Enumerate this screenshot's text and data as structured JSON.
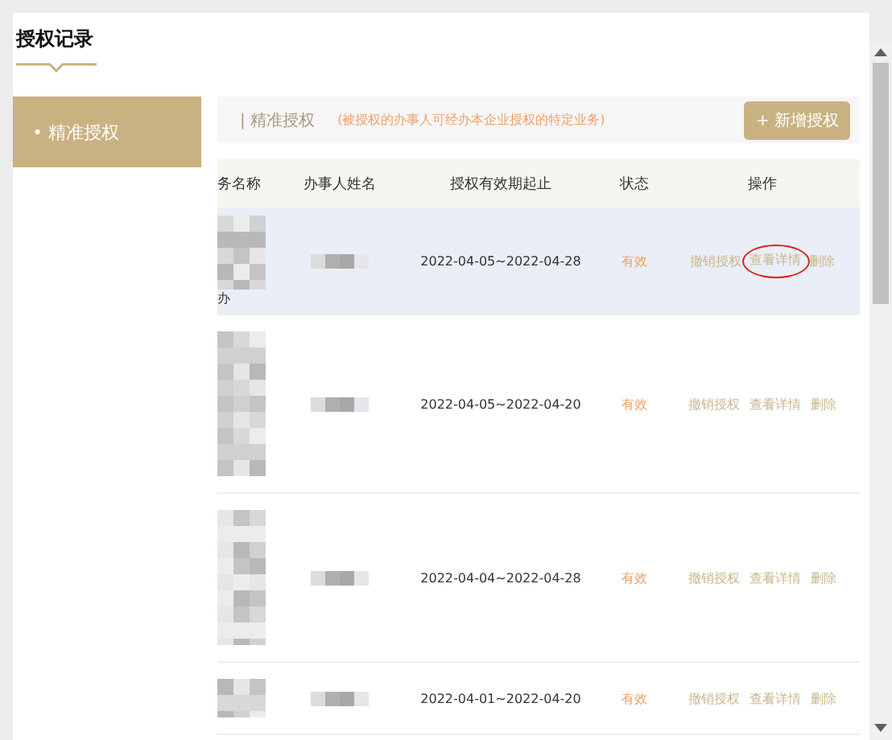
{
  "page_title": "授权记录",
  "sidebar": {
    "items": [
      {
        "label": "• 精准授权",
        "selected": true
      }
    ]
  },
  "section": {
    "title": "| 精准授权",
    "hint": "(被授权的办事人可经办本企业授权的特定业务)",
    "add_button": "+ 新增授权"
  },
  "table": {
    "columns": {
      "column_1": "务名称",
      "agent_name": "办事人姓名",
      "period": "授权有效期起止",
      "status": "状态",
      "actions": "操作"
    },
    "rows": [
      {
        "column_1": "办",
        "period": "2022-04-05~2022-04-28",
        "status": "有效",
        "actions": [
          {
            "label": "撤销授权",
            "circled": false
          },
          {
            "label": "查看详情",
            "circled": true
          },
          {
            "label": "删除",
            "circled": false
          }
        ],
        "selected": true
      },
      {
        "period": "2022-04-05~2022-04-20",
        "status": "有效",
        "actions": [
          {
            "label": "撤销授权",
            "circled": false
          },
          {
            "label": "查看详情",
            "circled": false
          },
          {
            "label": "删除",
            "circled": false
          }
        ],
        "selected": false
      },
      {
        "period": "2022-04-04~2022-04-28",
        "status": "有效",
        "actions": [
          {
            "label": "撤销授权",
            "circled": false
          },
          {
            "label": "查看详情",
            "circled": false
          },
          {
            "label": "删除",
            "circled": false
          }
        ],
        "selected": false
      },
      {
        "period": "2022-04-01~2022-04-20",
        "status": "有效",
        "actions": [
          {
            "label": "撤销授权",
            "circled": false
          },
          {
            "label": "查看详情",
            "circled": false
          },
          {
            "label": "删除",
            "circled": false
          }
        ],
        "selected": false
      }
    ]
  }
}
